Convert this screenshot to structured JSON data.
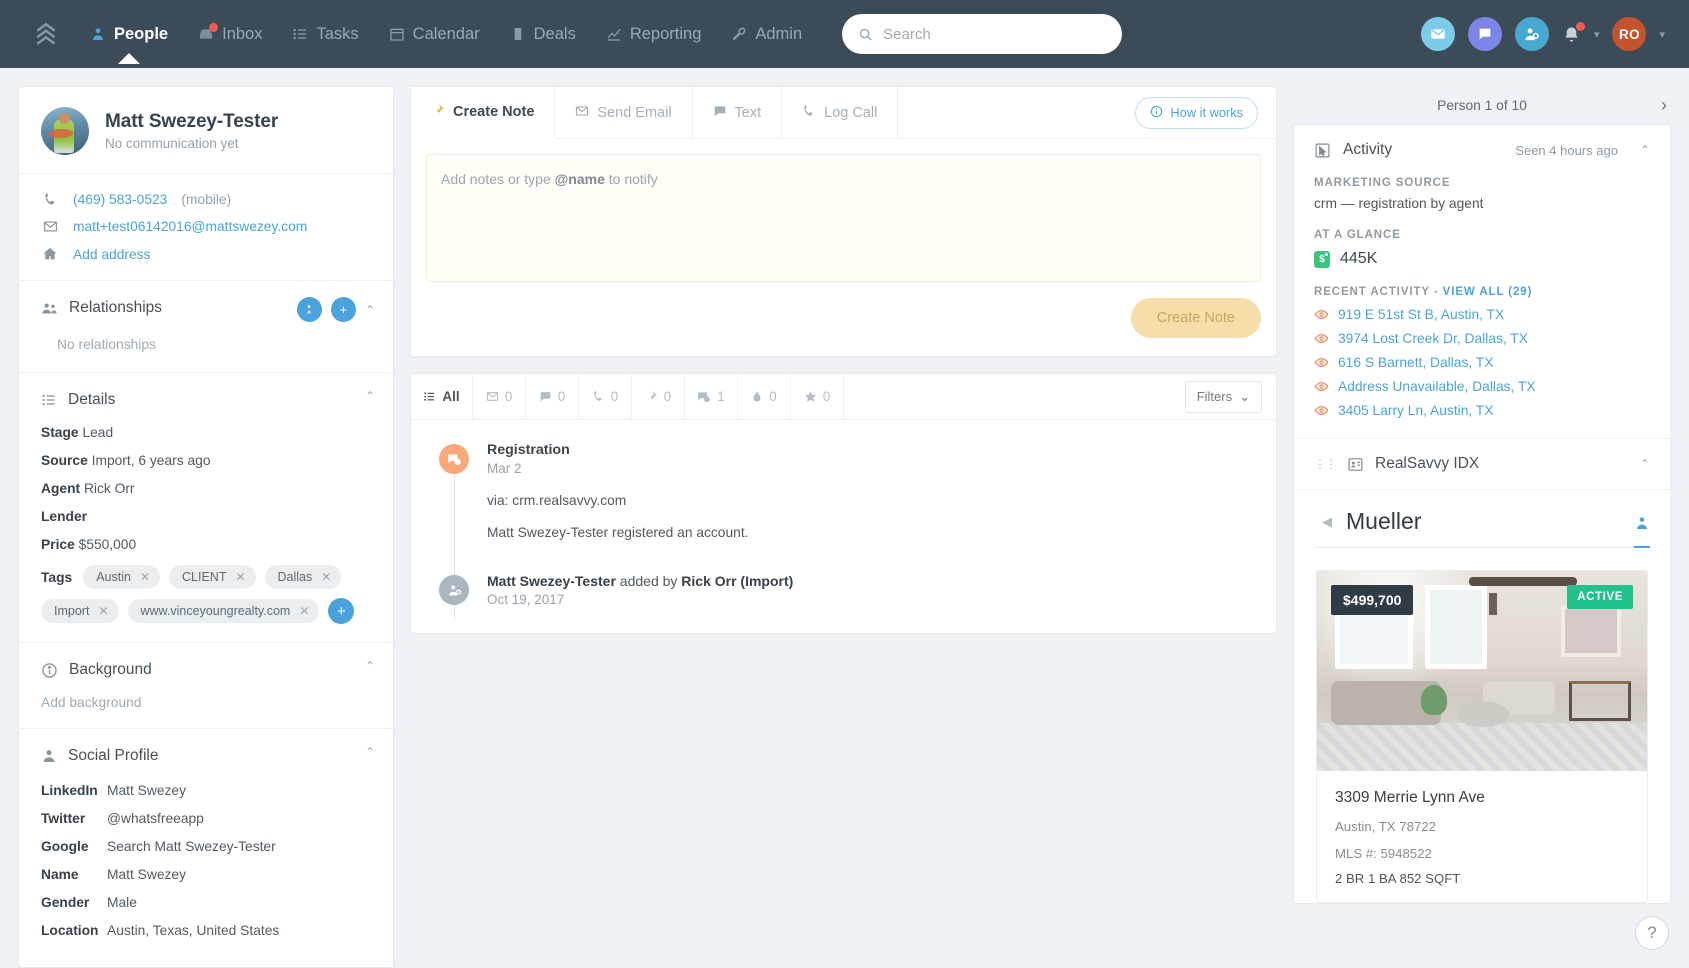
{
  "nav": {
    "items": [
      {
        "label": "People",
        "icon": "person-icon",
        "active": true,
        "badge": false
      },
      {
        "label": "Inbox",
        "icon": "inbox-icon",
        "active": false,
        "badge": true
      },
      {
        "label": "Tasks",
        "icon": "tasks-icon",
        "active": false,
        "badge": false
      },
      {
        "label": "Calendar",
        "icon": "calendar-icon",
        "active": false,
        "badge": false
      },
      {
        "label": "Deals",
        "icon": "deals-icon",
        "active": false,
        "badge": false
      },
      {
        "label": "Reporting",
        "icon": "chart-icon",
        "active": false,
        "badge": false
      },
      {
        "label": "Admin",
        "icon": "wrench-icon",
        "active": false,
        "badge": false
      }
    ],
    "search_placeholder": "Search",
    "search_value": "",
    "avatar_initials": "RO",
    "accent_blue": "#4aa3dd",
    "header_bg": "#3b4b58"
  },
  "person": {
    "name": "Matt Swezey-Tester",
    "status": "No communication yet",
    "phone": "(469) 583-0523",
    "phone_type": "(mobile)",
    "email": "matt+test06142016@mattswezey.com",
    "address_action": "Add address"
  },
  "relationships": {
    "title": "Relationships",
    "empty": "No relationships"
  },
  "details": {
    "title": "Details",
    "fields": [
      {
        "key": "Stage",
        "value": "Lead"
      },
      {
        "key": "Source",
        "value": "Import, 6 years ago"
      },
      {
        "key": "Agent",
        "value": "Rick Orr"
      },
      {
        "key": "Lender",
        "value": ""
      },
      {
        "key": "Price",
        "value": "$550,000"
      }
    ],
    "tags_label": "Tags",
    "tags": [
      "Austin",
      "CLIENT",
      "Dallas",
      "Import",
      "www.vinceyoungrealty.com"
    ]
  },
  "background": {
    "title": "Background",
    "placeholder": "Add background"
  },
  "social": {
    "title": "Social Profile",
    "rows": [
      {
        "key": "LinkedIn",
        "value": "Matt Swezey",
        "link": true
      },
      {
        "key": "Twitter",
        "value": "@whatsfreeapp",
        "link": true
      },
      {
        "key": "Google",
        "value": "Search Matt Swezey-Tester",
        "link": true
      },
      {
        "key": "Name",
        "value": "Matt Swezey",
        "link": false
      },
      {
        "key": "Gender",
        "value": "Male",
        "link": false
      },
      {
        "key": "Location",
        "value": "Austin, Texas, United States",
        "link": false
      }
    ]
  },
  "composer": {
    "tabs": [
      {
        "label": "Create Note",
        "icon": "pin-icon",
        "active": true
      },
      {
        "label": "Send Email",
        "icon": "envelope-icon",
        "active": false
      },
      {
        "label": "Text",
        "icon": "speech-bubble-icon",
        "active": false
      },
      {
        "label": "Log Call",
        "icon": "phone-icon",
        "active": false
      }
    ],
    "how_it_works": "How it works",
    "note_placeholder_pre": "Add notes or type ",
    "note_placeholder_bold": "@name",
    "note_placeholder_post": " to notify",
    "note_value": "",
    "submit_label": "Create Note"
  },
  "timeline": {
    "filters": [
      {
        "icon": "list-icon",
        "label": "All"
      },
      {
        "icon": "envelope-icon",
        "label": "0"
      },
      {
        "icon": "speech-bubble-icon",
        "label": "0"
      },
      {
        "icon": "phone-icon",
        "label": "0"
      },
      {
        "icon": "pin-icon",
        "label": "0"
      },
      {
        "icon": "chat-icon",
        "label": "1"
      },
      {
        "icon": "drop-icon",
        "label": "0"
      },
      {
        "icon": "star-icon",
        "label": "0"
      }
    ],
    "filters_button": "Filters",
    "entries": [
      {
        "title": "Registration",
        "date": "Mar 2",
        "via": "via: crm.realsavvy.com",
        "body": "Matt Swezey-Tester registered an account.",
        "dot": "chat-icon"
      },
      {
        "actor": "Matt Swezey-Tester",
        "mid": " added by ",
        "by": "Rick Orr (Import)",
        "date": "Oct 19, 2017",
        "dot": "person-add-icon"
      }
    ]
  },
  "rightpanel": {
    "pager": "Person 1 of 10",
    "activity": {
      "title": "Activity",
      "seen": "Seen 4 hours ago",
      "marketing_source_label": "MARKETING SOURCE",
      "marketing_source_value": "crm — registration by agent",
      "at_a_glance_label": "AT A GLANCE",
      "at_a_glance_value": "445K",
      "recent_label": "RECENT ACTIVITY",
      "recent_link": "VIEW ALL (29)",
      "recent_items": [
        "919 E 51st St B, Austin, TX",
        "3974 Lost Creek Dr, Dallas, TX",
        "616 S Barnett, Dallas, TX",
        "Address Unavailable, Dallas, TX",
        "3405 Larry Ln, Austin, TX"
      ]
    },
    "idx": {
      "title": "RealSavvy IDX",
      "saved_search": "Mueller",
      "listing": {
        "price": "$499,700",
        "status": "ACTIVE",
        "address": "3309 Merrie Lynn Ave",
        "city": "Austin, TX 78722",
        "mls": "MLS #: 5948522",
        "specs": "2 BR 1 BA 852 SQFT"
      }
    }
  },
  "help": "?"
}
